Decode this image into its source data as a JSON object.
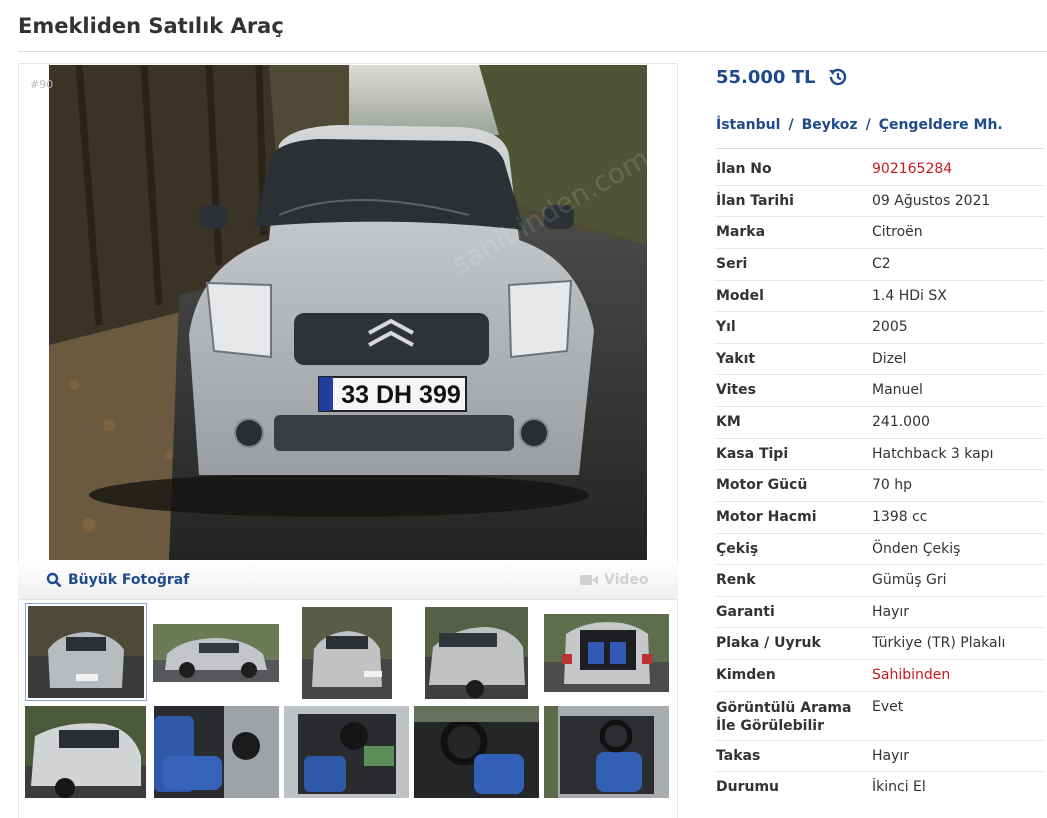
{
  "page": {
    "title": "Emekliden Satılık Araç"
  },
  "gallery": {
    "listing_id_watermark": "#90",
    "big_photo_label": "Büyük Fotoğraf",
    "video_label": "Video",
    "plate_text": "33 DH 399",
    "thumbnail_count": 10
  },
  "price": {
    "value": "55.000 TL"
  },
  "location": {
    "city": "İstanbul",
    "district": "Beykoz",
    "neighborhood": "Çengeldere Mh.",
    "separator": "/"
  },
  "details": [
    {
      "key": "İlan No",
      "value": "902165284",
      "highlight": true
    },
    {
      "key": "İlan Tarihi",
      "value": "09 Ağustos 2021"
    },
    {
      "key": "Marka",
      "value": "Citroën"
    },
    {
      "key": "Seri",
      "value": "C2"
    },
    {
      "key": "Model",
      "value": "1.4 HDi SX"
    },
    {
      "key": "Yıl",
      "value": "2005"
    },
    {
      "key": "Yakıt",
      "value": "Dizel"
    },
    {
      "key": "Vites",
      "value": "Manuel"
    },
    {
      "key": "KM",
      "value": "241.000"
    },
    {
      "key": "Kasa Tipi",
      "value": "Hatchback 3 kapı"
    },
    {
      "key": "Motor Gücü",
      "value": "70 hp"
    },
    {
      "key": "Motor Hacmi",
      "value": "1398 cc"
    },
    {
      "key": "Çekiş",
      "value": "Önden Çekiş"
    },
    {
      "key": "Renk",
      "value": "Gümüş Gri"
    },
    {
      "key": "Garanti",
      "value": "Hayır"
    },
    {
      "key": "Plaka / Uyruk",
      "value": "Türkiye (TR) Plakalı"
    },
    {
      "key": "Kimden",
      "value": "Sahibinden",
      "highlight": true
    },
    {
      "key": "Görüntülü Arama İle Görülebilir",
      "value": "Evet"
    },
    {
      "key": "Takas",
      "value": "Hayır"
    },
    {
      "key": "Durumu",
      "value": "İkinci El"
    }
  ],
  "colors": {
    "link_blue": "#1f4a8c",
    "highlight_red": "#c9171c"
  }
}
